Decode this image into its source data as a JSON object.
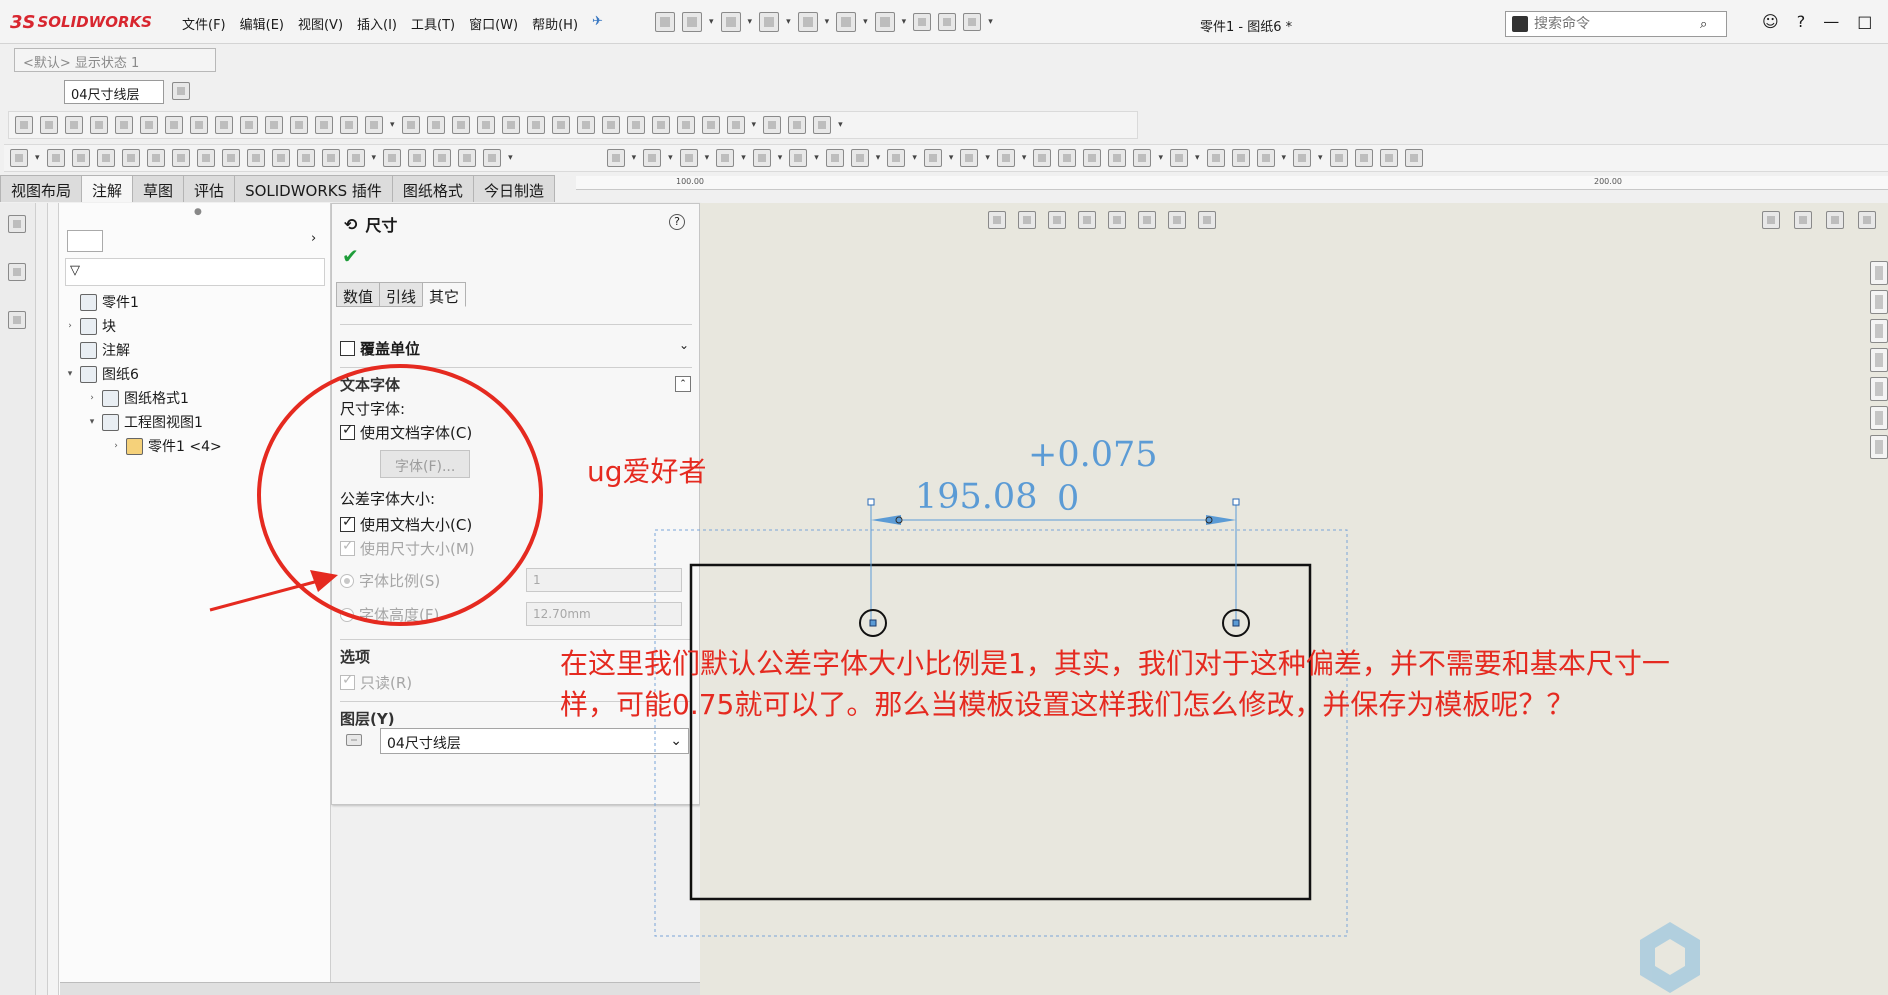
{
  "app": {
    "logo_ds": "3S",
    "logo_text": "SOLIDWORKS",
    "document_title": "零件1 - 图纸6 *"
  },
  "menu": [
    "文件(F)",
    "编辑(E)",
    "视图(V)",
    "插入(I)",
    "工具(T)",
    "窗口(W)",
    "帮助(H)"
  ],
  "search": {
    "placeholder": "搜索命令"
  },
  "window_controls": [
    "?",
    "—",
    "□"
  ],
  "config": {
    "display_state": "<默认> 显示状态 1",
    "layer": "04尺寸线层"
  },
  "cm_tabs": [
    "视图布局",
    "注解",
    "草图",
    "评估",
    "SOLIDWORKS 插件",
    "图纸格式",
    "今日制造"
  ],
  "cm_active_tab": "注解",
  "ruler": {
    "mark_a": "100.00",
    "mark_b": "200.00"
  },
  "tree": {
    "items": [
      {
        "label": "零件1",
        "expand": ""
      },
      {
        "label": "块",
        "expand": "›"
      },
      {
        "label": "注解",
        "expand": ""
      },
      {
        "label": "图纸6",
        "expand": "▾"
      },
      {
        "label": "图纸格式1",
        "expand": "›"
      },
      {
        "label": "工程图视图1",
        "expand": "▾"
      },
      {
        "label": "零件1 <4>",
        "expand": "›"
      }
    ]
  },
  "pm": {
    "title": "尺寸",
    "help": "?",
    "tabs": [
      "数值",
      "引线",
      "其它"
    ],
    "active_tab": "其它",
    "override_units": "覆盖单位",
    "text_font_heading": "文本字体",
    "dim_font_label": "尺寸字体:",
    "use_doc_font": "使用文档字体(C)",
    "font_button": "字体(F)...",
    "tol_font_size_label": "公差字体大小:",
    "use_doc_size": "使用文档大小(C)",
    "use_dim_size": "使用尺寸大小(M)",
    "font_scale": "字体比例(S)",
    "font_scale_value": "1",
    "font_height": "字体高度(F)",
    "font_height_value": "12.70mm",
    "options_heading": "选项",
    "read_only": "只读(R)",
    "layer_heading": "图层(Y)",
    "layer_value": "04尺寸线层"
  },
  "drawing": {
    "dimension_value": "195.08",
    "tol_upper": "+0.075",
    "tol_lower": "0"
  },
  "annotations": {
    "ug": "ug爱好者",
    "note_line1": "在这里我们默认公差字体大小比例是1，其实，我们对于这种偏差，并不需要和基本尺寸一",
    "note_line2": "样，可能0.75就可以了。那么当模板设置这样我们怎么修改，并保存为模板呢？？"
  },
  "colors": {
    "annotation_red": "#e52a20",
    "dimension_blue": "#5b9bd5",
    "brand_red": "#d8262f"
  }
}
